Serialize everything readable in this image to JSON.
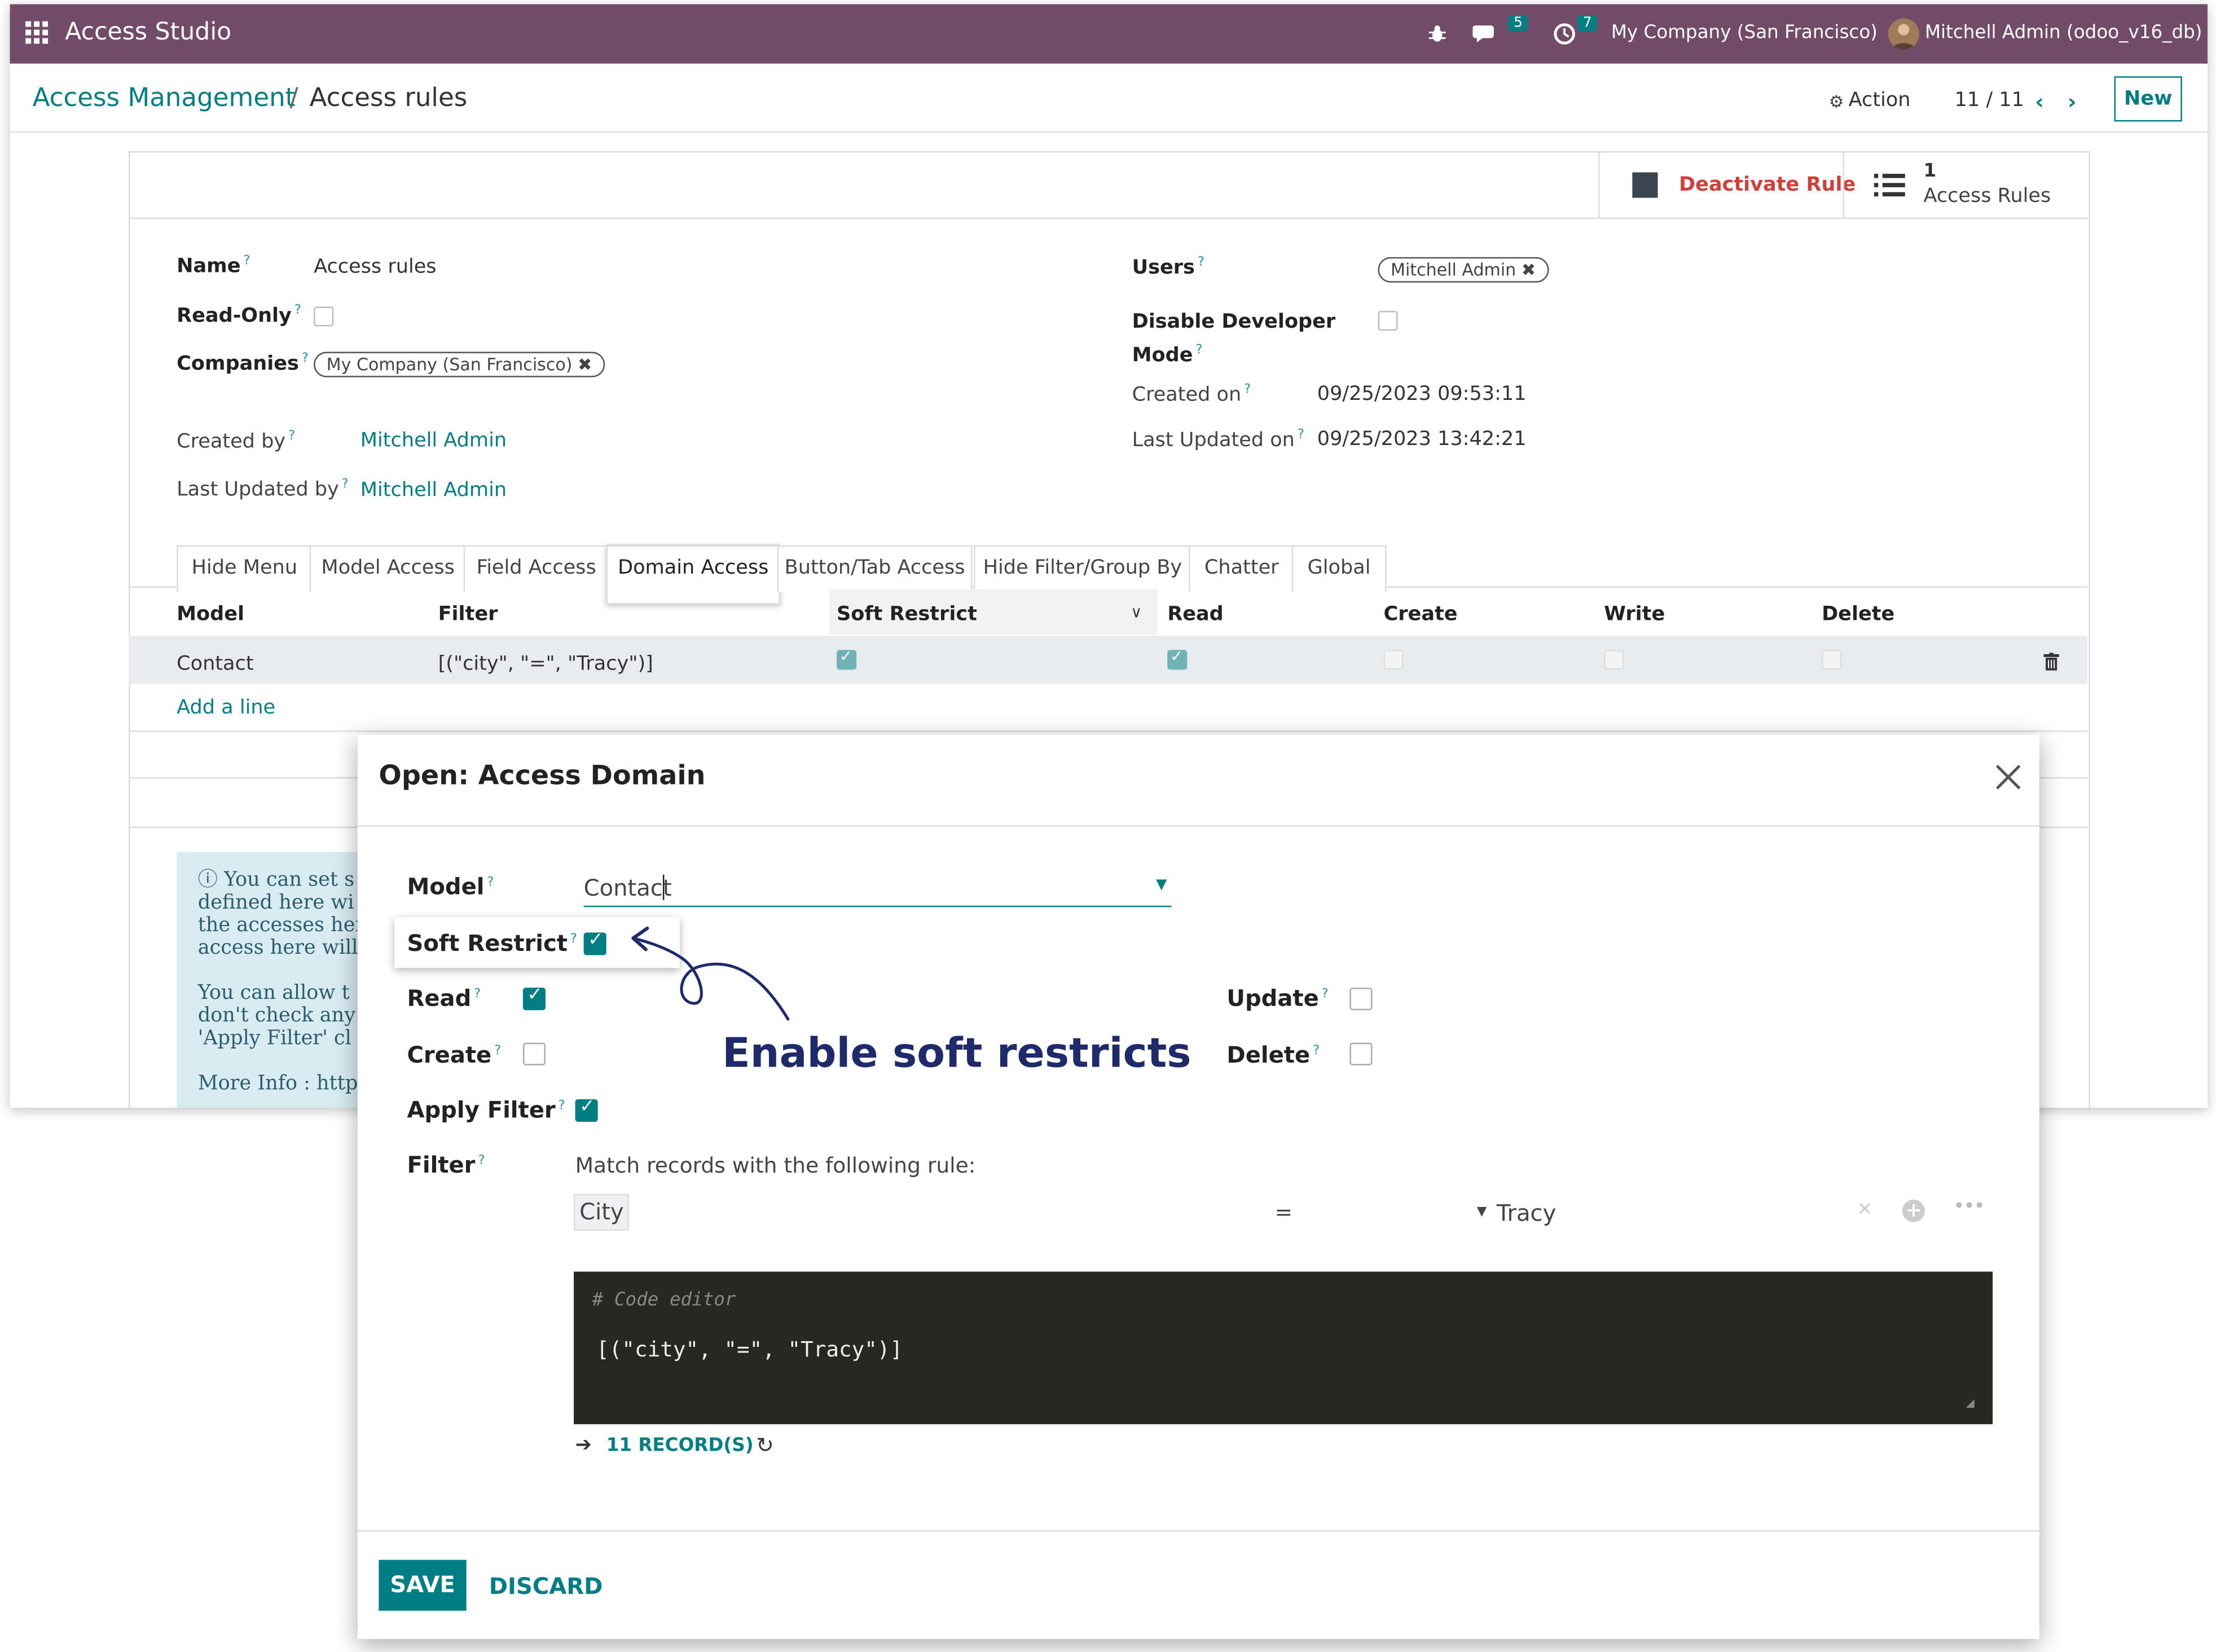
{
  "topbar": {
    "app_name": "Access Studio",
    "messages_count": "5",
    "activities_count": "7",
    "company": "My Company (San Francisco)",
    "user": "Mitchell Admin (odoo_v16_db)"
  },
  "breadcrumb": {
    "parent": "Access Management",
    "separator": "/",
    "current": "Access rules"
  },
  "control": {
    "action_label": "Action",
    "pager": "11 / 11",
    "new_label": "New"
  },
  "buttonbox": {
    "deactivate_label": "Deactivate Rule",
    "rules_count": "1",
    "rules_label": "Access Rules"
  },
  "form": {
    "name_label": "Name",
    "name_value": "Access rules",
    "readonly_label": "Read-Only",
    "companies_label": "Companies",
    "company_tag": "My Company (San Francisco)",
    "created_by_label": "Created by",
    "created_by_value": "Mitchell Admin",
    "last_updated_by_label": "Last Updated by",
    "last_updated_by_value": "Mitchell Admin",
    "users_label": "Users",
    "user_tag": "Mitchell Admin",
    "disable_dev_label_1": "Disable Developer",
    "disable_dev_label_2": "Mode",
    "created_on_label": "Created on",
    "created_on_value": "09/25/2023 09:53:11",
    "last_updated_on_label": "Last Updated on",
    "last_updated_on_value": "09/25/2023 13:42:21"
  },
  "tabs": [
    "Hide Menu",
    "Model Access",
    "Field Access",
    "Domain Access",
    "Button/Tab Access",
    "Hide Filter/Group By",
    "Chatter",
    "Global"
  ],
  "table": {
    "headers": [
      "Model",
      "Filter",
      "Soft Restrict",
      "Read",
      "Create",
      "Write",
      "Delete"
    ],
    "row": {
      "model": "Contact",
      "filter": "[(\"city\", \"=\", \"Tracy\")]"
    },
    "add_line": "Add a line"
  },
  "info": {
    "lines": [
      "You can set s",
      "defined here wi",
      "the accesses her",
      "access here will",
      "",
      "You can allow t",
      "don't check any",
      "'Apply Filter' cl",
      "",
      "More Info : http"
    ]
  },
  "modal": {
    "title": "Open: Access Domain",
    "model_label": "Model",
    "model_value": "Contact",
    "soft_restrict_label": "Soft Restrict",
    "read_label": "Read",
    "create_label": "Create",
    "update_label": "Update",
    "delete_label": "Delete",
    "apply_filter_label": "Apply Filter",
    "filter_label": "Filter",
    "match_text": "Match records with the following rule:",
    "rule_field": "City",
    "rule_op": "=",
    "rule_value": "Tracy",
    "code_comment": "# Code editor",
    "code_value": "[(\"city\", \"=\", \"Tracy\")]",
    "records_label": "11 RECORD(S)",
    "save_label": "SAVE",
    "discard_label": "DISCARD"
  },
  "annotation": {
    "text": "Enable soft restricts"
  },
  "colors": {
    "topbar": "#714b67",
    "accent": "#017e84",
    "deactivate": "#d23f3a",
    "annotation": "#1f2a6b"
  }
}
